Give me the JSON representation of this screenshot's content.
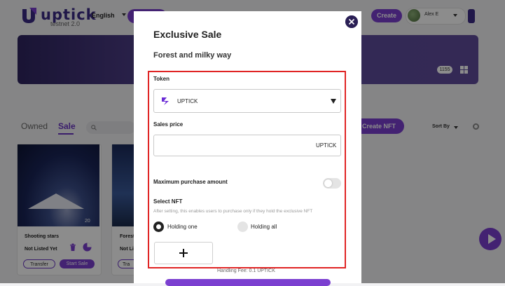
{
  "header": {
    "logo_text": "uptick",
    "logo_sub": "testnet 2.0",
    "language": "English",
    "create_label": "Create",
    "user_name": "Alex E"
  },
  "banner": {
    "count": "1155"
  },
  "tabs": {
    "owned": "Owned",
    "sale": "Sale"
  },
  "toolbar": {
    "create_nft": "Create NFT",
    "sort_by": "Sort By"
  },
  "cards": [
    {
      "title": "Shooting stars",
      "status": "Not Listed Yet",
      "count": "20",
      "transfer": "Transfer",
      "start_sale": "Start Sale"
    },
    {
      "title": "Forest",
      "status": "Not Li",
      "transfer": "Tra"
    }
  ],
  "modal": {
    "title": "Exclusive Sale",
    "subtitle": "Forest and milky way",
    "token_label": "Token",
    "token_value": "UPTICK",
    "price_label": "Sales price",
    "price_unit": "UPTICK",
    "max_label": "Maximum purchase amount",
    "select_label": "Select NFT",
    "select_help": "After setting, this enables users to purchase only if they hold the exclusive NFT",
    "holding_one": "Holding one",
    "holding_all": "Holding all",
    "fee": "Handling Fee:  0.1 UPTICK"
  },
  "colors": {
    "accent": "#7b3fd0",
    "dark": "#2a1f55",
    "highlight_border": "#e02424"
  }
}
